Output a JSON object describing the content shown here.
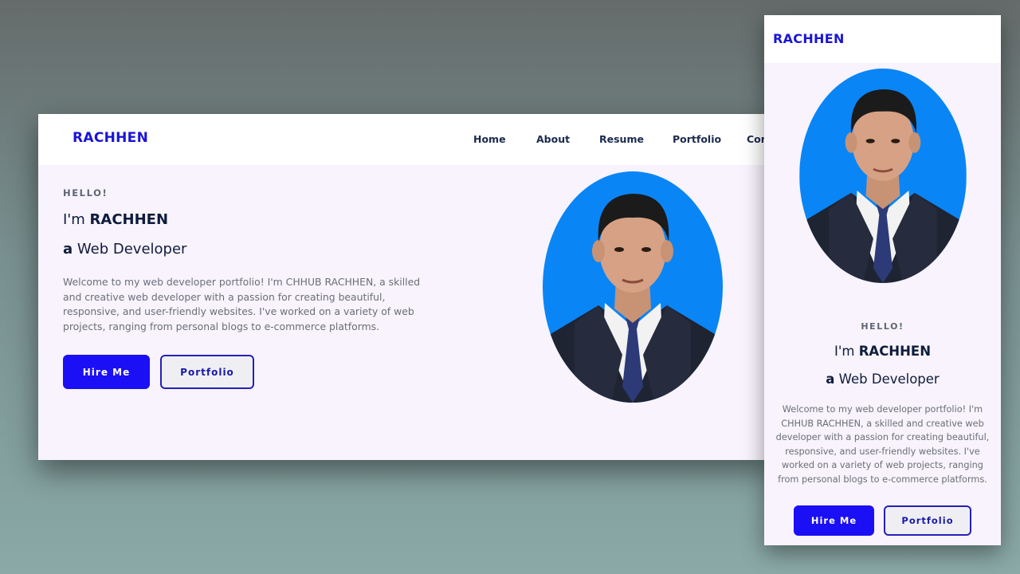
{
  "brand": "RACHHEN",
  "nav": {
    "home": "Home",
    "about": "About",
    "resume": "Resume",
    "portfolio": "Portfolio",
    "contact_partial": "Cor"
  },
  "hero": {
    "greeting": "HELLO!",
    "intro_prefix": "I'm",
    "name": "RACHHEN",
    "role_prefix": "a",
    "role": "Web Developer",
    "description": "Welcome to my web developer portfolio! I'm CHHUB RACHHEN, a skilled and creative web developer with a passion for creating beautiful, responsive, and user-friendly websites. I've worked on a variety of web projects, ranging from personal blogs to e-commerce platforms.",
    "hire_label": "Hire Me",
    "portfolio_label": "Portfolio"
  },
  "colors": {
    "brand": "#1a14d6",
    "primary_button": "#1b0ff5",
    "photo_background": "#0a85f5",
    "page_background": "#f8f3fc",
    "suit": "#1f2433",
    "tie": "#2c3a78"
  },
  "icons": {
    "profile_photo": "portrait-photo"
  }
}
